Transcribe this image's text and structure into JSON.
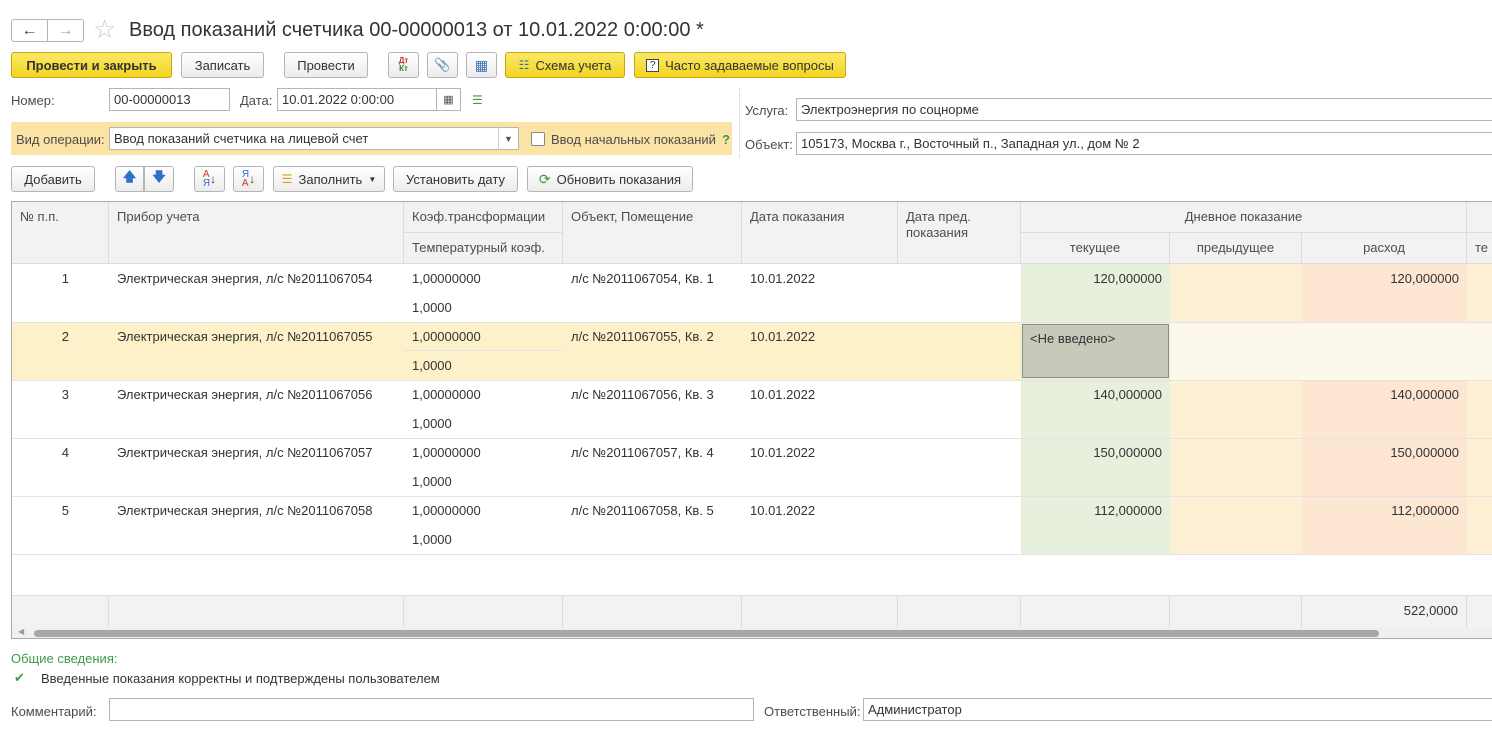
{
  "window": {
    "title": "Ввод показаний счетчика 00-00000013 от 10.01.2022 0:00:00 *"
  },
  "toolbar": {
    "post_close": "Провести и закрыть",
    "save": "Записать",
    "post": "Провести",
    "dt_kt": "Дт Кт",
    "scheme": "Схема учета",
    "faq": "Часто задаваемые вопросы",
    "faq_mark": "?"
  },
  "header": {
    "number_label": "Номер:",
    "number_value": "00-00000013",
    "date_label": "Дата:",
    "date_value": "10.01.2022  0:00:00",
    "operation_label": "Вид операции:",
    "operation_value": "Ввод показаний счетчика на лицевой счет",
    "initial_label": "Ввод начальных показаний",
    "help_mark": "?",
    "service_label": "Услуга:",
    "service_value": "Электроэнергия по соцнорме",
    "object_label": "Объект:",
    "object_value": "105173, Москва г., Восточный п., Западная ул., дом № 2"
  },
  "table_toolbar": {
    "add": "Добавить",
    "fill": "Заполнить",
    "set_date": "Установить дату",
    "refresh": "Обновить показания"
  },
  "table": {
    "headers": {
      "num": "№ п.п.",
      "device": "Прибор учета",
      "coef": "Коэф.трансформации",
      "temp": "Температурный коэф.",
      "object": "Объект, Помещение",
      "date": "Дата показания",
      "prev_date": "Дата пред. показания",
      "day": "Дневное показание",
      "current": "текущее",
      "previous": "предыдущее",
      "expense": "расход",
      "cut": "те"
    },
    "rows": [
      {
        "num": "1",
        "device": "Электрическая энергия, л/с №2011067054",
        "coef": "1,00000000",
        "temp": "1,0000",
        "object": "л/с №2011067054, Кв. 1",
        "date": "10.01.2022",
        "current": "120,000000",
        "expense": "120,000000"
      },
      {
        "num": "2",
        "device": "Электрическая энергия, л/с №2011067055",
        "coef": "1,00000000",
        "temp": "1,0000",
        "object": "л/с №2011067055, Кв. 2",
        "date": "10.01.2022",
        "current": "<Не введено>",
        "expense": ""
      },
      {
        "num": "3",
        "device": "Электрическая энергия, л/с №2011067056",
        "coef": "1,00000000",
        "temp": "1,0000",
        "object": "л/с №2011067056, Кв. 3",
        "date": "10.01.2022",
        "current": "140,000000",
        "expense": "140,000000"
      },
      {
        "num": "4",
        "device": "Электрическая энергия, л/с №2011067057",
        "coef": "1,00000000",
        "temp": "1,0000",
        "object": "л/с №2011067057, Кв. 4",
        "date": "10.01.2022",
        "current": "150,000000",
        "expense": "150,000000"
      },
      {
        "num": "5",
        "device": "Электрическая энергия, л/с №2011067058",
        "coef": "1,00000000",
        "temp": "1,0000",
        "object": "л/с №2011067058, Кв. 5",
        "date": "10.01.2022",
        "current": "112,000000",
        "expense": "112,000000"
      }
    ],
    "total_expense": "522,0000"
  },
  "general": {
    "title": "Общие сведения:",
    "confirmed": "Введенные показания корректны и подтверждены пользователем"
  },
  "bottom": {
    "comment_label": "Комментарий:",
    "comment_value": "",
    "responsible_label": "Ответственный:",
    "responsible_value": "Администратор"
  },
  "colors": {
    "accent_yellow": "#f5d92e",
    "current_col": "#e6f0dd",
    "previous_col": "#fdf0d4",
    "expense_col": "#fde6d2",
    "selected_row": "#fcf1c8",
    "green": "#3f9a46"
  }
}
